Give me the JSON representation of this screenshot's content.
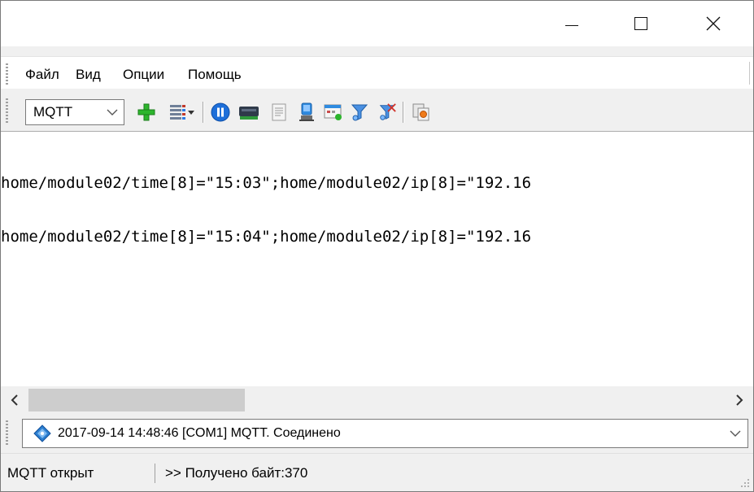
{
  "titlebar": {
    "minimize_glyph": "—",
    "maximize_glyph": "☐",
    "close_glyph": "✕"
  },
  "menu": {
    "items": [
      {
        "label": "Файл"
      },
      {
        "label": "Вид"
      },
      {
        "label": "Опции"
      },
      {
        "label": "Помощь"
      }
    ]
  },
  "toolbar": {
    "protocol_select": {
      "value": "MQTT"
    },
    "icons": [
      "add-icon",
      "columns-dropdown-icon",
      "pause-icon",
      "port-icon",
      "document-icon",
      "device-icon",
      "calendar-window-icon",
      "filter-icon",
      "filter-remove-icon",
      "export-icon"
    ]
  },
  "log": {
    "lines": [
      "home/module02/time[8]=\"15:03\";home/module02/ip[8]=\"192.16",
      "home/module02/time[8]=\"15:04\";home/module02/ip[8]=\"192.16"
    ]
  },
  "status_select": {
    "value": "2017-09-14 14:48:46 [COM1] MQTT. Соединено",
    "icon": "info-diamond-icon"
  },
  "statusbar": {
    "left": "MQTT открыт",
    "right": ">> Получено байт:370"
  },
  "colors": {
    "accent_blue": "#1e6fd9",
    "green_add": "#2db52d"
  }
}
